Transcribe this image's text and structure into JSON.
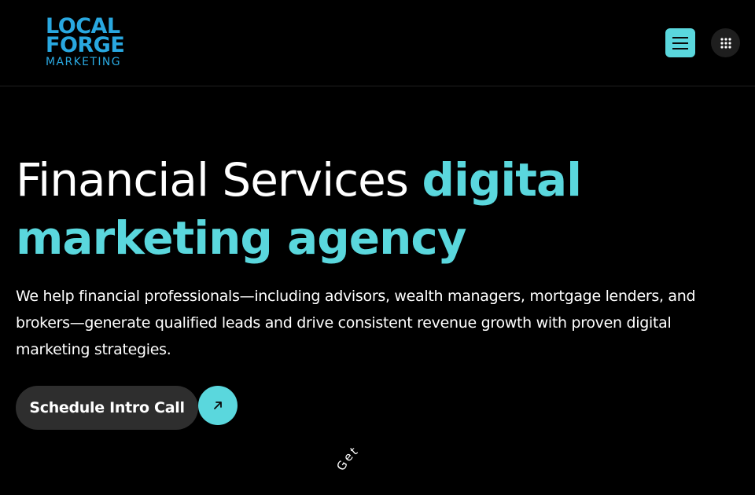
{
  "header": {
    "logo": {
      "line1": "LOCAL",
      "line2": "FORGE",
      "line3": "MARKETING"
    },
    "menu_icon": "hamburger-menu-icon",
    "apps_icon": "grid-dots-icon"
  },
  "hero": {
    "title_light": "Financial Services ",
    "title_accent": "digital marketing agency",
    "description": "We help financial professionals—including advisors, wealth managers, mortgage lenders, and brokers—generate qualified leads and drive consistent revenue growth with proven digital marketing strategies.",
    "cta_label": "Schedule Intro Call",
    "cta_icon": "arrow-up-right-icon"
  },
  "badge": {
    "text": "Get a FREE"
  },
  "colors": {
    "accent": "#5ad7dd",
    "logo_blue": "#29a8e0",
    "background": "#000000",
    "button_dark": "#2e2e2e"
  }
}
